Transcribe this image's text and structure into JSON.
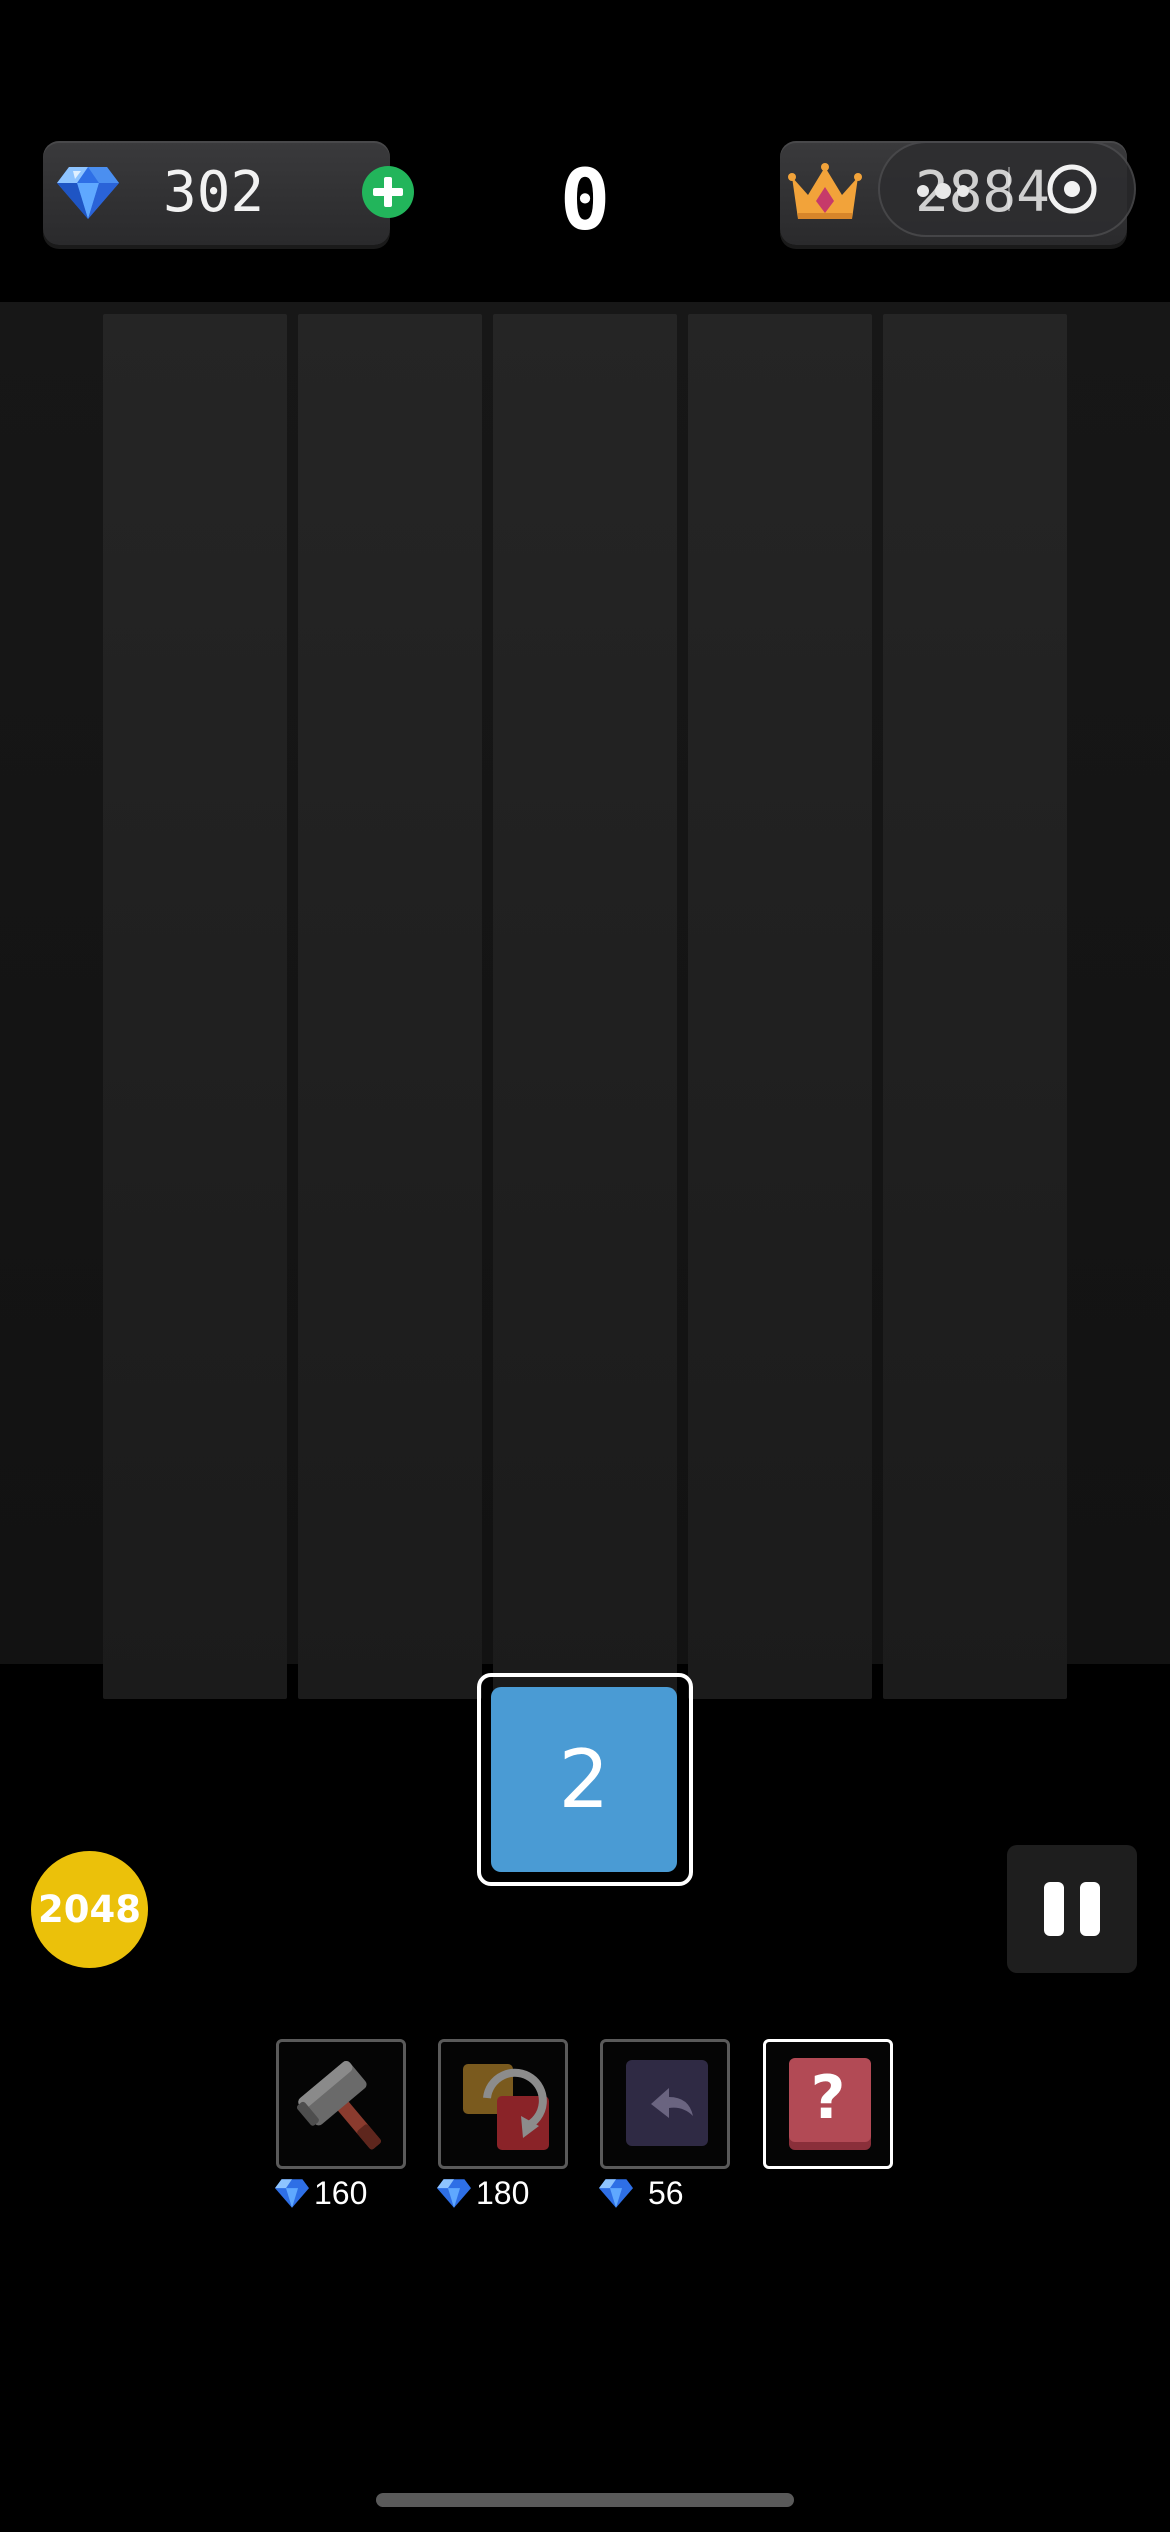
{
  "top_bar": {
    "gems": "302",
    "score": "0",
    "best_score": "2884"
  },
  "board": {
    "columns": 5,
    "tiles": []
  },
  "next_tile": {
    "value": "2",
    "color": "#4a9bd4"
  },
  "goal_badge": "2048",
  "powerups": [
    {
      "icon": "hammer-icon",
      "price": "160"
    },
    {
      "icon": "swap-icon",
      "price": "180"
    },
    {
      "icon": "undo-icon",
      "price": "56"
    },
    {
      "icon": "mystery-icon",
      "label": "?"
    }
  ],
  "colors": {
    "gem_add_button": "#22b55b",
    "goal_badge": "#ebc10a",
    "next_tile": "#4a9bd4",
    "mystery_box": "#b24a55"
  }
}
